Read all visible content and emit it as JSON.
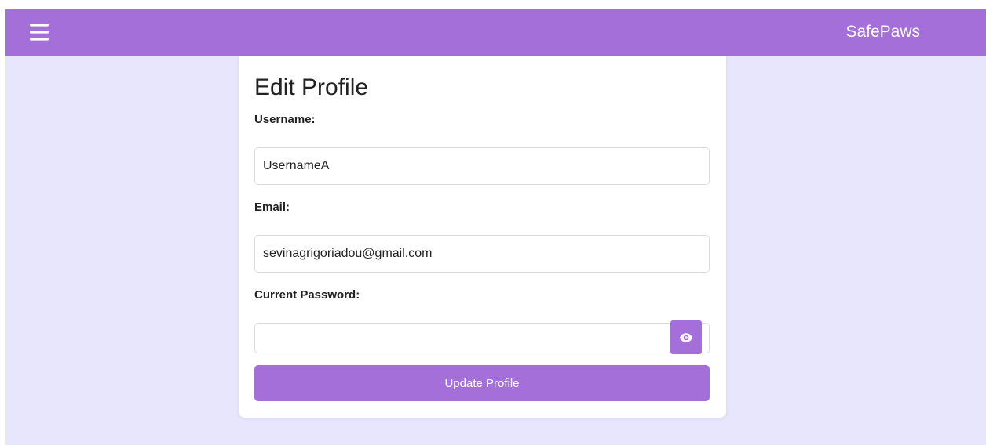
{
  "header": {
    "brand": "SafePaws",
    "menu_icon": "hamburger-menu-icon",
    "color": "#a56fd9"
  },
  "form": {
    "title": "Edit Profile",
    "username_label": "Username:",
    "username_value": "UsernameA",
    "email_label": "Email:",
    "email_value": "sevinagrigoriadou@gmail.com",
    "password_label": "Current Password:",
    "password_value": "",
    "toggle_icon": "eye-icon",
    "submit_label": "Update Profile"
  },
  "colors": {
    "accent": "#a56fd9",
    "background": "#e8e6fd",
    "card": "#ffffff"
  }
}
